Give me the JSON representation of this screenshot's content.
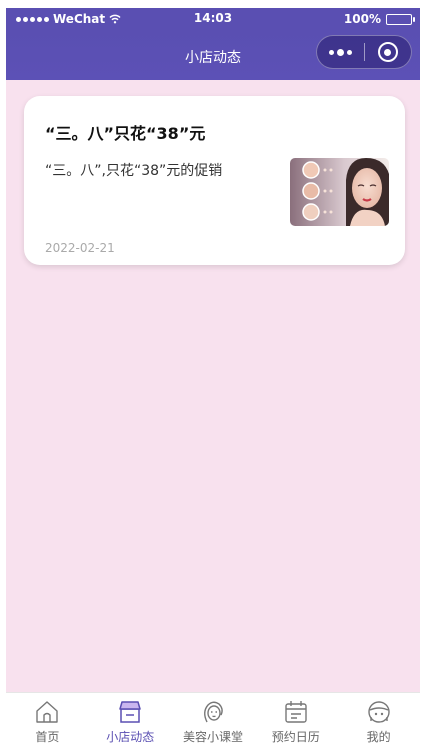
{
  "status_bar": {
    "carrier": "WeChat",
    "time": "14:03",
    "battery": "100%"
  },
  "nav": {
    "title": "小店动态"
  },
  "posts": [
    {
      "title": "“三。八”只花“38”元",
      "description": "“三。八”,只花“38”元的促销",
      "date": "2022-02-21",
      "thumbnail_icon": "skincare-promo-image"
    }
  ],
  "tabs": [
    {
      "label": "首页",
      "icon": "home-icon",
      "active": false
    },
    {
      "label": "小店动态",
      "icon": "shop-icon",
      "active": true
    },
    {
      "label": "美容小课堂",
      "icon": "beauty-face-icon",
      "active": false
    },
    {
      "label": "预约日历",
      "icon": "calendar-icon",
      "active": false
    },
    {
      "label": "我的",
      "icon": "profile-icon",
      "active": false
    }
  ],
  "colors": {
    "accent": "#5a4fb2",
    "background": "#f8e1ee",
    "card": "#ffffff",
    "inactive_tab": "#666666"
  }
}
